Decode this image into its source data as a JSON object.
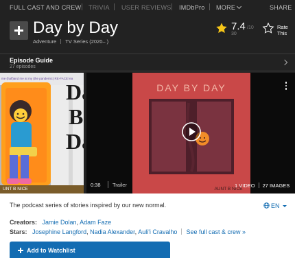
{
  "subnav": {
    "full_cast": "FULL CAST AND CREW",
    "trivia": "TRIVIA",
    "user_reviews": "USER REVIEWS",
    "imdbpro": "IMDbPro",
    "more": "MORE",
    "share": "SHARE"
  },
  "title": {
    "name": "Day by Day",
    "genre": "Adventure",
    "type_year": "TV Series (2020– )"
  },
  "rating": {
    "value": "7.4",
    "out_of": "/10",
    "count": "30",
    "rate_label_1": "Rate",
    "rate_label_2": "This"
  },
  "episode_guide": {
    "label": "Episode Guide",
    "count": "27 episodes"
  },
  "poster": {
    "title_text": [
      "Da",
      "B",
      "Da"
    ],
    "caption": "UNT B NICE"
  },
  "video": {
    "art_title": "DAY BY DAY",
    "art_caption": "AUNT B NICE",
    "duration": "0:38",
    "kind": "Trailer",
    "videos_link": "1 VIDEO",
    "images_link": "27 IMAGES"
  },
  "plot": "The podcast series of stories inspired by our new normal.",
  "language": "EN",
  "creators": {
    "label": "Creators:",
    "names": [
      "Jamie Dolan",
      "Adam Faze"
    ]
  },
  "stars": {
    "label": "Stars:",
    "names": [
      "Josephine Langford",
      "Nadia Alexander",
      "Auli'i Cravalho"
    ],
    "see_all": "See full cast & crew »"
  },
  "watchlist": "Add to Watchlist",
  "colors": {
    "accent_blue": "#136cb2",
    "star_gold": "#f5c518",
    "dark_bg": "#222222"
  }
}
